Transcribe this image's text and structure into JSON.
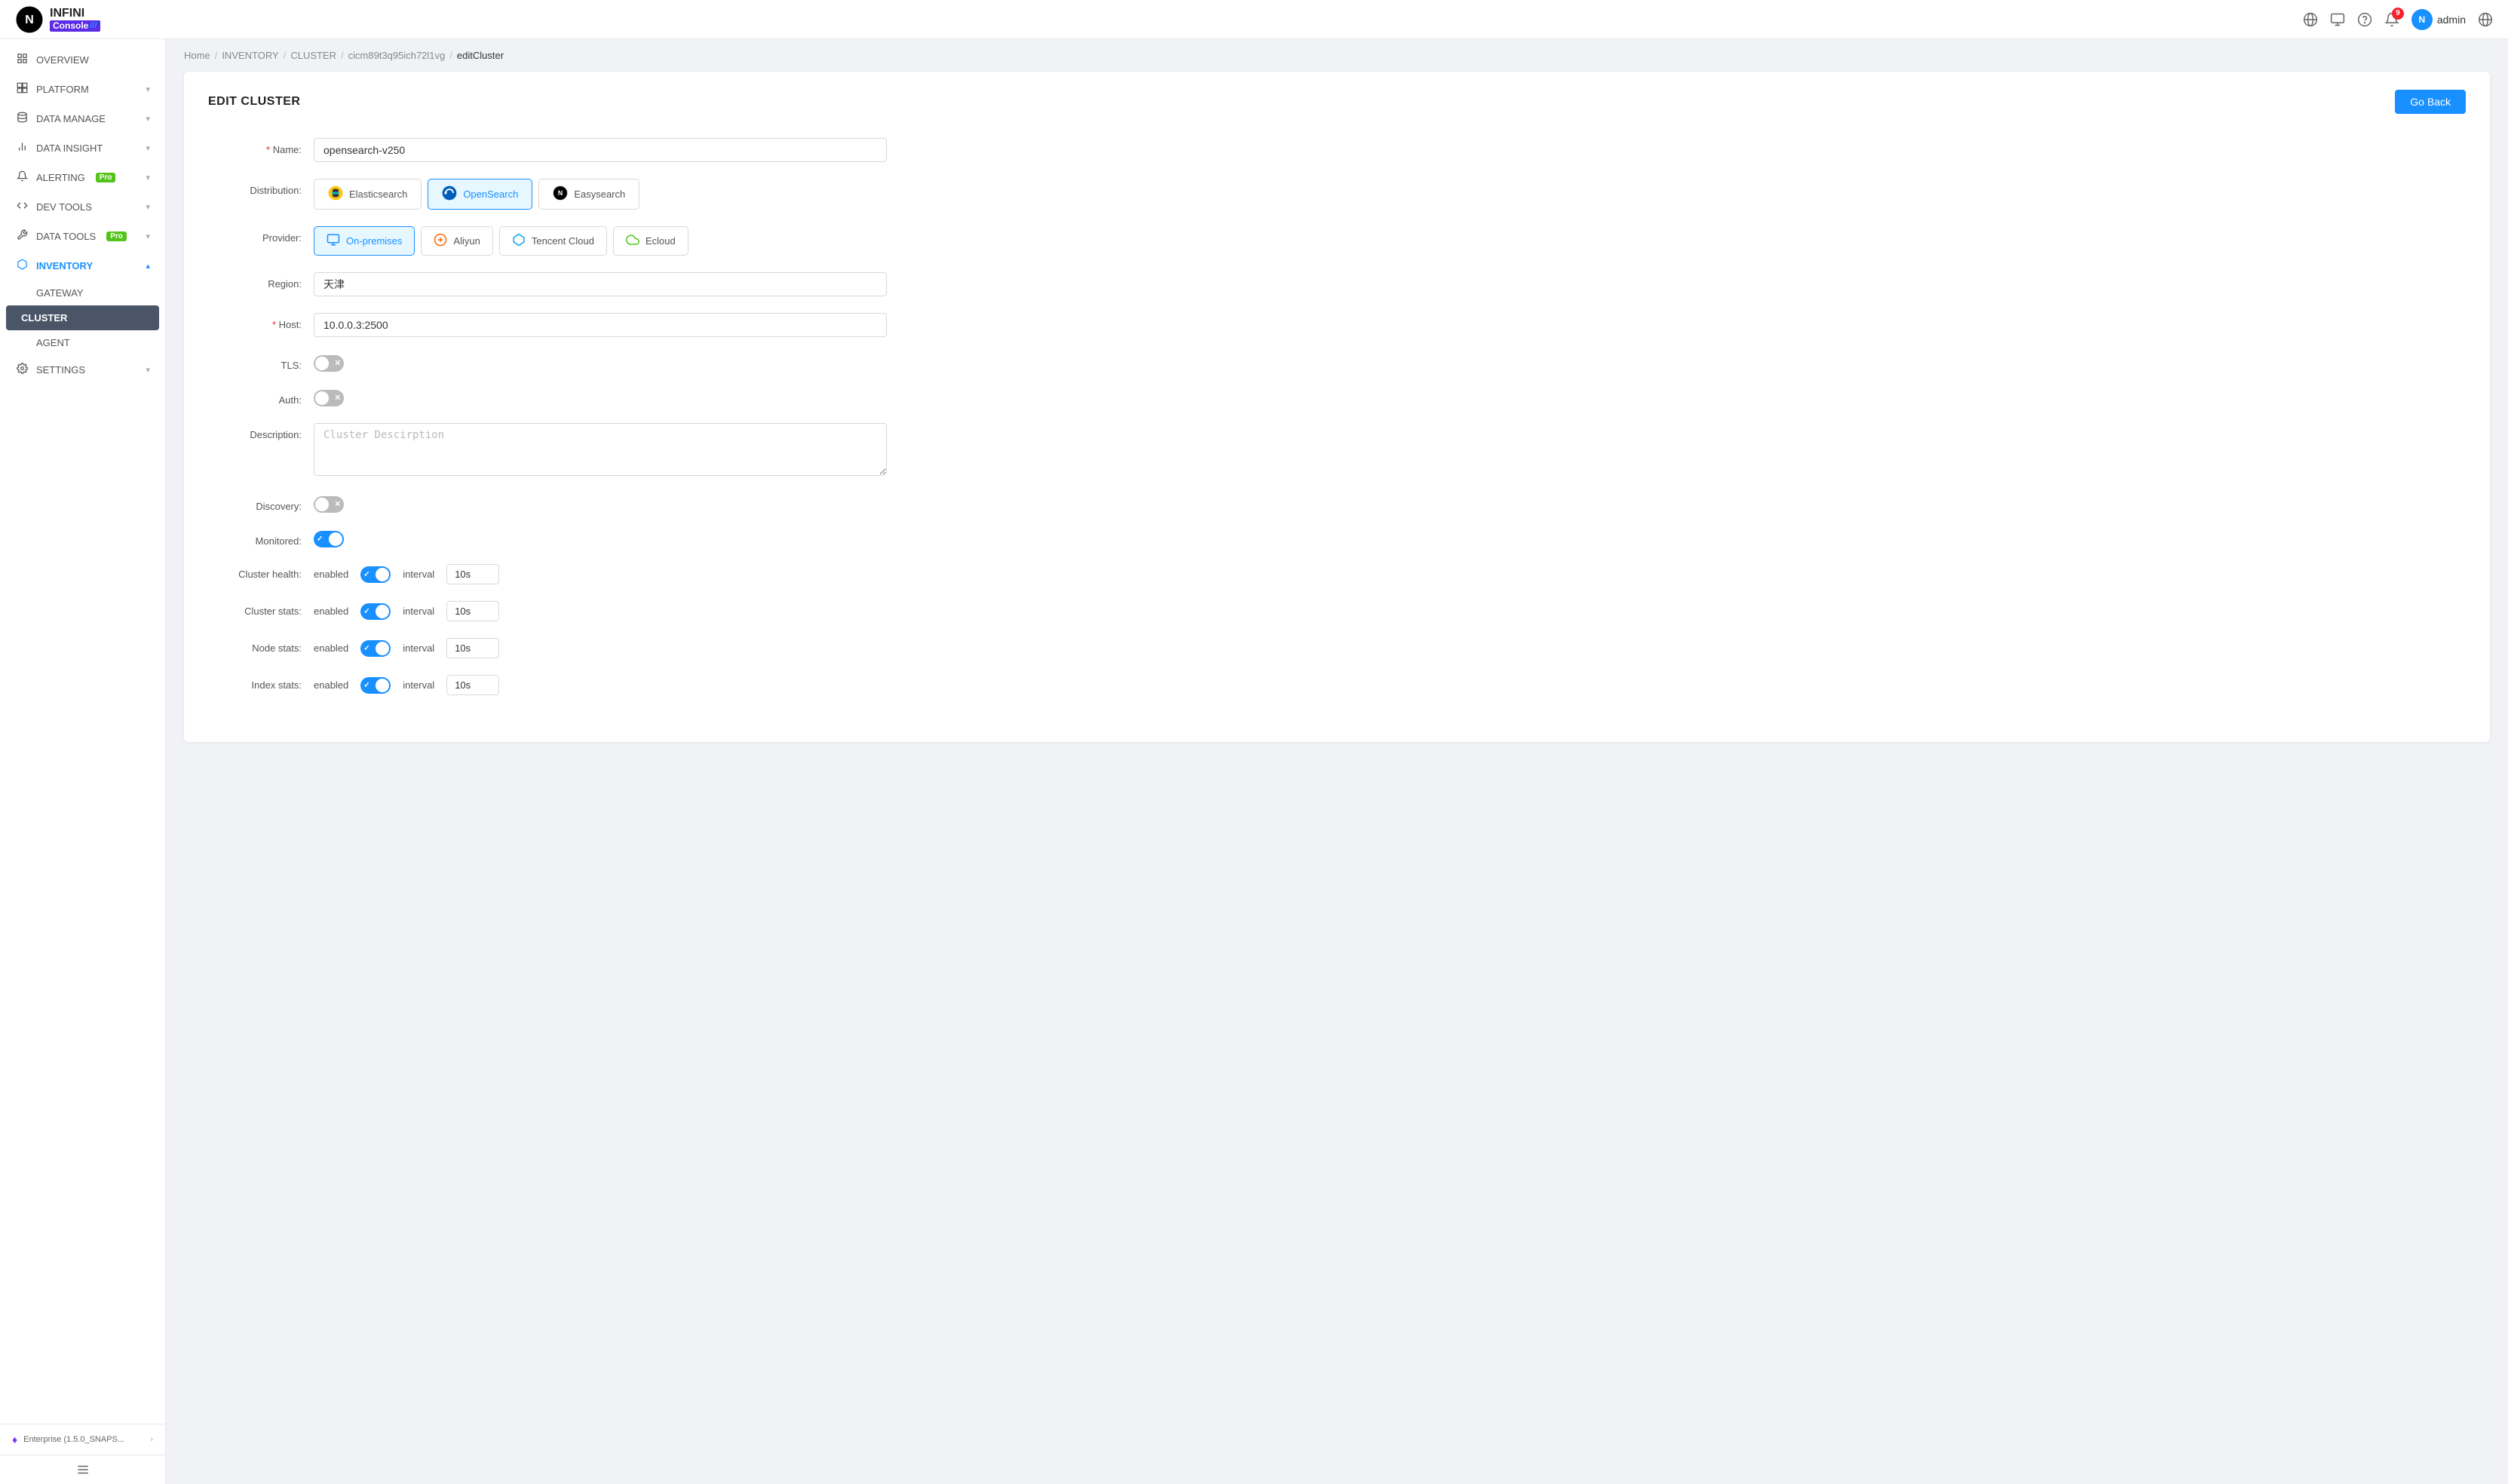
{
  "topbar": {
    "logo": {
      "infini": "INFINI",
      "console": "Console",
      "bars": "///"
    },
    "icons": {
      "global": "🌐",
      "monitor": "⬜",
      "help": "?",
      "bell": "🔔",
      "notification_count": "9",
      "admin_label": "admin",
      "lang": "🌐"
    }
  },
  "sidebar": {
    "items": [
      {
        "id": "overview",
        "label": "OVERVIEW",
        "icon": "⊞",
        "has_arrow": false
      },
      {
        "id": "platform",
        "label": "PLATFORM",
        "icon": "▦",
        "has_arrow": true
      },
      {
        "id": "data_manage",
        "label": "DATA MANAGE",
        "icon": "⊟",
        "has_arrow": true
      },
      {
        "id": "data_insight",
        "label": "DATA INSIGHT",
        "icon": "📊",
        "has_arrow": true
      },
      {
        "id": "alerting",
        "label": "ALERTING",
        "icon": "🔔",
        "has_arrow": true,
        "pro": true
      },
      {
        "id": "dev_tools",
        "label": "DEV TOOLS",
        "icon": "⚙",
        "has_arrow": true
      },
      {
        "id": "data_tools",
        "label": "DATA TOOLS",
        "icon": "🔧",
        "has_arrow": true,
        "pro": true
      },
      {
        "id": "inventory",
        "label": "INVENTORY",
        "icon": "📦",
        "has_arrow": true,
        "active": true
      }
    ],
    "inventory_sub": [
      {
        "id": "gateway",
        "label": "GATEWAY"
      },
      {
        "id": "cluster",
        "label": "CLUSTER",
        "active": true
      },
      {
        "id": "agent",
        "label": "AGENT"
      }
    ],
    "settings": {
      "label": "SETTINGS",
      "icon": "⚙",
      "has_arrow": true
    },
    "footer": {
      "text": "Enterprise (1.5.0_SNAPS...",
      "icon": "♦"
    }
  },
  "breadcrumb": {
    "items": [
      "Home",
      "INVENTORY",
      "CLUSTER",
      "cicm89t3q95ich72l1vg",
      "editCluster"
    ]
  },
  "page": {
    "title": "EDIT CLUSTER",
    "go_back": "Go Back"
  },
  "form": {
    "name_label": "Name:",
    "name_value": "opensearch-v250",
    "distribution_label": "Distribution:",
    "distributions": [
      {
        "id": "elasticsearch",
        "label": "Elasticsearch",
        "active": false
      },
      {
        "id": "opensearch",
        "label": "OpenSearch",
        "active": true
      },
      {
        "id": "easysearch",
        "label": "Easysearch",
        "active": false
      }
    ],
    "provider_label": "Provider:",
    "providers": [
      {
        "id": "on_premises",
        "label": "On-premises",
        "active": true
      },
      {
        "id": "aliyun",
        "label": "Aliyun",
        "active": false
      },
      {
        "id": "tencent_cloud",
        "label": "Tencent Cloud",
        "active": false
      },
      {
        "id": "ecloud",
        "label": "Ecloud",
        "active": false
      }
    ],
    "region_label": "Region:",
    "region_value": "天津",
    "host_label": "* Host:",
    "host_value": "10.0.0.3:2500",
    "tls_label": "TLS:",
    "tls_enabled": false,
    "auth_label": "Auth:",
    "auth_enabled": false,
    "description_label": "Description:",
    "description_placeholder": "Cluster Descirption",
    "discovery_label": "Discovery:",
    "discovery_enabled": false,
    "monitored_label": "Monitored:",
    "monitored_enabled": true,
    "cluster_health_label": "Cluster health:",
    "cluster_health_enabled": true,
    "cluster_health_interval": "10s",
    "cluster_stats_label": "Cluster stats:",
    "cluster_stats_enabled": true,
    "cluster_stats_interval": "10s",
    "node_stats_label": "Node stats:",
    "node_stats_enabled": true,
    "node_stats_interval": "10s",
    "index_stats_label": "Index stats:",
    "index_stats_enabled": true,
    "index_stats_interval": "10s",
    "interval_label": "interval",
    "enabled_label": "enabled"
  }
}
